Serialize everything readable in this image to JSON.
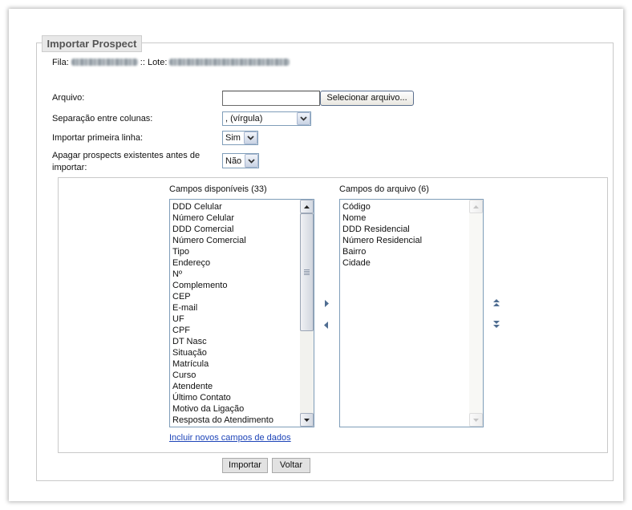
{
  "panel": {
    "legend": "Importar Prospect",
    "fila_label": "Fila:",
    "lote_label": ":: Lote:"
  },
  "form": {
    "arquivo": {
      "label": "Arquivo:",
      "value": "",
      "button_label": "Selecionar arquivo..."
    },
    "separacao": {
      "label": "Separação entre colunas:",
      "selected": ", (vírgula)"
    },
    "primeira_linha": {
      "label": "Importar primeira linha:",
      "selected": "Sim"
    },
    "apagar": {
      "label": "Apagar prospects existentes antes de importar:",
      "selected": "Não"
    }
  },
  "fields": {
    "available": {
      "title": "Campos disponíveis (33)",
      "items": [
        "DDD Celular",
        "Número Celular",
        "DDD Comercial",
        "Número Comercial",
        "Tipo",
        "Endereço",
        "Nº",
        "Complemento",
        "CEP",
        "E-mail",
        "UF",
        "CPF",
        "DT Nasc",
        "Situação",
        "Matrícula",
        "Curso",
        "Atendente",
        "Último Contato",
        "Motivo da Ligação",
        "Resposta do Atendimento"
      ],
      "scroll_position": 0
    },
    "file": {
      "title": "Campos do arquivo (6)",
      "items": [
        "Código",
        "Nome",
        "DDD Residencial",
        "Número Residencial",
        "Bairro",
        "Cidade"
      ],
      "scrollbar_enabled": false
    },
    "add_link": "Incluir novos campos de dados"
  },
  "actions": {
    "import_label": "Importar",
    "back_label": "Voltar"
  },
  "icons": {
    "select_arrow": "chevron-down-icon",
    "scroll_up": "scroll-up-arrow-icon",
    "scroll_down": "scroll-down-arrow-icon",
    "add_field": "triangle-right-icon",
    "remove_field": "triangle-left-icon",
    "move_up": "double-triangle-up-icon",
    "move_down": "double-triangle-down-icon"
  },
  "colors": {
    "link": "#1d44b8",
    "legend_text": "#555555",
    "legend_bg": "#e8e8e8",
    "control_border": "#7f9db9",
    "frame_border": "#c9c9c9",
    "move_arrow": "#4f6d91"
  }
}
